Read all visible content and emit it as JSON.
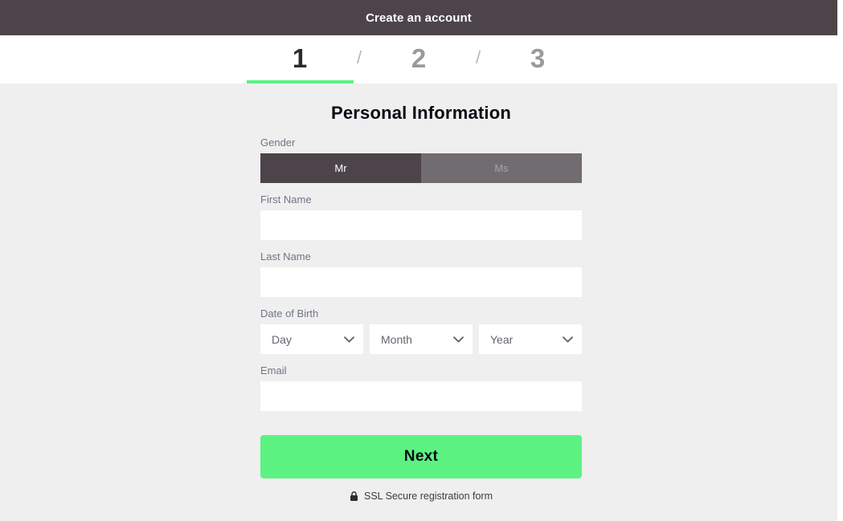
{
  "header": {
    "title": "Create an account"
  },
  "steps": {
    "separator": "/",
    "items": [
      {
        "label": "1",
        "active": true
      },
      {
        "label": "2",
        "active": false
      },
      {
        "label": "3",
        "active": false
      }
    ]
  },
  "form": {
    "title": "Personal Information",
    "gender": {
      "label": "Gender",
      "options": [
        {
          "label": "Mr",
          "selected": true
        },
        {
          "label": "Ms",
          "selected": false
        }
      ]
    },
    "first_name": {
      "label": "First Name",
      "value": "",
      "placeholder": ""
    },
    "last_name": {
      "label": "Last Name",
      "value": "",
      "placeholder": ""
    },
    "date_of_birth": {
      "label": "Date of Birth",
      "day": {
        "value": "Day"
      },
      "month": {
        "value": "Month"
      },
      "year": {
        "value": "Year"
      }
    },
    "email": {
      "label": "Email",
      "value": "",
      "placeholder": ""
    },
    "submit": {
      "label": "Next"
    },
    "ssl_note": {
      "icon": "lock-icon",
      "text": "SSL Secure registration form"
    }
  },
  "colors": {
    "header_bg": "#4d4449",
    "accent_green": "#5cf282",
    "content_bg": "#efefef",
    "gender_selected": "#4d4449",
    "gender_unselected": "#716c70",
    "label_gray": "#6e7685"
  }
}
